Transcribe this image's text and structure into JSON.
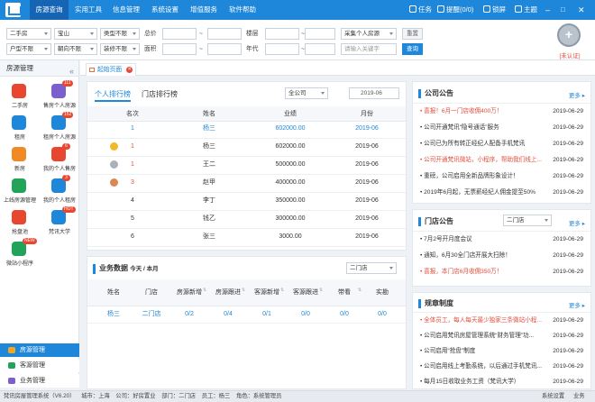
{
  "app": {
    "logo_icon": "house-logo-icon"
  },
  "nav": [
    {
      "label": "房源查询",
      "active": true
    },
    {
      "label": "实用工具"
    },
    {
      "label": "信息管理"
    },
    {
      "label": "系统设置"
    },
    {
      "label": "增值服务"
    },
    {
      "label": "软件帮助"
    }
  ],
  "top_right": {
    "task": "任务",
    "reminder": "提醒(0/0)",
    "lock": "锁屏",
    "theme": "主题"
  },
  "filters": {
    "row1": {
      "type": "二手房",
      "district": "宝山",
      "category": "类型不限",
      "price_label": "总价",
      "tilde1": "~",
      "floor_label": "楼层",
      "tilde2": "~",
      "source": "采集个人房源",
      "reset": "重置"
    },
    "row2": {
      "layout": "户型不限",
      "direction": "朝向不限",
      "decoration": "装修不限",
      "area_label": "面积",
      "tilde1": "~",
      "year_label": "年代",
      "tilde2": "~",
      "keyword_placeholder": "请输入关键字",
      "query": "查询"
    }
  },
  "badge": {
    "label": "[未认证]"
  },
  "sidebar": {
    "title": "房源管理",
    "items": [
      {
        "label": "二手房",
        "color": "#e8462f",
        "badge": ""
      },
      {
        "label": "售房个人房源",
        "color": "#7b5fd0",
        "badge": "111"
      },
      {
        "label": "租房",
        "color": "#1f87d9",
        "badge": ""
      },
      {
        "label": "租房个人房源",
        "color": "#1f87d9",
        "badge": "152"
      },
      {
        "label": "新房",
        "color": "#f08a24",
        "badge": ""
      },
      {
        "label": "我的个人售房",
        "color": "#e8462f",
        "badge": "6"
      },
      {
        "label": "上线房源管理",
        "color": "#22a35a",
        "badge": ""
      },
      {
        "label": "我的个人租房",
        "color": "#1f87d9",
        "badge": "3"
      },
      {
        "label": "抢盘池",
        "color": "#e8462f",
        "badge": ""
      },
      {
        "label": "梵讯大学",
        "color": "#1f87d9",
        "badge": "HOT"
      },
      {
        "label": "微站小程序",
        "color": "#22a35a",
        "badge": "NEW"
      }
    ],
    "bottom": [
      {
        "label": "房源管理",
        "active": true
      },
      {
        "label": "客源管理"
      },
      {
        "label": "业务管理"
      }
    ]
  },
  "tabs": {
    "home": "起始页面"
  },
  "ranking": {
    "tab1": "个人排行榜",
    "tab2": "门店排行榜",
    "company": "全公司",
    "month": "2019-06",
    "headers": [
      "名次",
      "姓名",
      "业绩",
      "月份"
    ],
    "rows": [
      {
        "rank": "1",
        "name": "杨三",
        "amount": "602000.00",
        "month": "2019-06",
        "highlight": true
      },
      {
        "rank": "1",
        "name": "杨三",
        "amount": "602000.00",
        "month": "2019-06",
        "highlight": false
      },
      {
        "rank": "1",
        "name": "王二",
        "amount": "500000.00",
        "month": "2019-06",
        "highlight": false
      },
      {
        "rank": "3",
        "name": "赵甲",
        "amount": "400000.00",
        "month": "2019-06",
        "highlight": false
      },
      {
        "rank": "4",
        "name": "李丁",
        "amount": "350000.00",
        "month": "2019-06",
        "highlight": false
      },
      {
        "rank": "5",
        "name": "钱乙",
        "amount": "300000.00",
        "month": "2019-06",
        "highlight": false
      },
      {
        "rank": "6",
        "name": "张三",
        "amount": "3000.00",
        "month": "2019-06",
        "highlight": false
      }
    ]
  },
  "business": {
    "title": "业务数据",
    "period": "今天 / 本月",
    "store": "二门店",
    "headers": [
      "姓名",
      "门店",
      "房源新增",
      "房源跟进",
      "客源新增",
      "客源跟进",
      "带看",
      "实勘"
    ],
    "row": [
      "杨三",
      "二门店",
      "0/2",
      "0/4",
      "0/1",
      "0/0",
      "0/0",
      "0/0"
    ]
  },
  "company_notice": {
    "title": "公司公告",
    "more": "更多",
    "items": [
      {
        "text": "喜报！6月一门店收佣400万！",
        "date": "2019-06-29",
        "red": true
      },
      {
        "text": "公司开通梵讯“隐号通话”服务",
        "date": "2019-06-29",
        "red": false
      },
      {
        "text": "公司已为所有转正经纪人配备手机梵讯",
        "date": "2019-06-29",
        "red": false
      },
      {
        "text": "公司开通梵讯微站，小程序，帮助我们线上...",
        "date": "2019-06-29",
        "red": true
      },
      {
        "text": "重磅，公司启用全新品牌形象设计！",
        "date": "2019-06-29",
        "red": false
      },
      {
        "text": "2019年6月起，无票薪经纪人佣金提至50%",
        "date": "2019-06-29",
        "red": false
      }
    ]
  },
  "store_notice": {
    "title": "门店公告",
    "store": "二门店",
    "more": "更多",
    "items": [
      {
        "text": "7月2号开月度会议",
        "date": "2019-06-29",
        "red": false
      },
      {
        "text": "通知，6月30全门店开展大扫除！",
        "date": "2019-06-29",
        "red": false
      },
      {
        "text": "喜报，本门店6月收佣350万！",
        "date": "2019-06-29",
        "red": true
      }
    ]
  },
  "rules": {
    "title": "规章制度",
    "more": "更多",
    "items": [
      {
        "text": "全体员工，每人每天最少独家三条微站小程...",
        "date": "2019-06-29",
        "red": true
      },
      {
        "text": "公司启用梵讯房屋管理系统“财务管理”功...",
        "date": "2019-06-29",
        "red": false
      },
      {
        "text": "公司启用“抢盘”制度",
        "date": "2019-06-29",
        "red": false
      },
      {
        "text": "公司启用线上考勤系统，以后通过手机梵讯...",
        "date": "2019-06-29",
        "red": false
      },
      {
        "text": "每月15日收取业务工资（梵讯大学）",
        "date": "2019-06-29",
        "red": false
      }
    ]
  },
  "status": {
    "system": "梵讯房屋管理系统（V6.20）",
    "city": "城市：上海",
    "company": "公司：好房置业",
    "dept": "部门：二门店",
    "staff": "员工：杨三",
    "role": "角色：系统管理员",
    "right1": "系统设置",
    "right2": "业务"
  },
  "colors": {
    "accent": "#1f87d9",
    "red": "#e24d3a",
    "nav_bg": "#1f87d9"
  }
}
